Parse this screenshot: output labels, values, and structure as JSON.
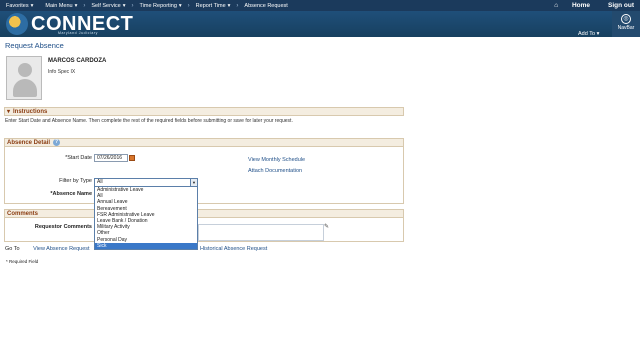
{
  "topnav": {
    "items": [
      {
        "label": "Favorites"
      },
      {
        "label": "Main Menu"
      },
      {
        "label": "Self Service"
      },
      {
        "label": "Time Reporting"
      },
      {
        "label": "Report Time"
      },
      {
        "label": "Absence Request"
      }
    ],
    "home_label": "Home",
    "signout_label": "Sign out"
  },
  "banner": {
    "logo_text": "CONNECT",
    "logo_subtext": "Maryland Judiciary",
    "add_to_label": "Add To",
    "navbar_label": "NavBar"
  },
  "page": {
    "title": "Request Absence"
  },
  "employee": {
    "name": "MARCOS CARDOZA",
    "job_title": "Info Spec IX"
  },
  "instructions": {
    "header": "Instructions",
    "text": "Enter Start Date and Absence Name. Then complete the rest of the required fields before submitting or save for later your request."
  },
  "absence_detail": {
    "header": "Absence Detail",
    "start_date_label": "*Start Date",
    "start_date_value": "07/26/2016",
    "view_monthly_schedule": "View Monthly Schedule",
    "attach_documentation": "Attach Documentation",
    "filter_by_type_label": "Filter by Type",
    "filter_by_type_value": "All",
    "absence_name_label": "*Absence Name",
    "filter_options": [
      "Administrative Leave",
      "All",
      "Annual Leave",
      "Bereavement",
      "FSR Administrative Leave",
      "Leave Bank / Donation",
      "Military Activity",
      "Other",
      "Personal Day",
      "Sick"
    ],
    "highlighted_option": "Sick"
  },
  "comments": {
    "header": "Comments",
    "requestor_label": "Requestor Comments"
  },
  "goto": {
    "label": "Go To",
    "view_absence_request": "View Absence Request",
    "historical": "Historical Absence Request"
  },
  "footer": {
    "required_note": "* Required Field"
  },
  "colors": {
    "nav_bg": "#1b3a5c",
    "banner_bg": "#1f4f7a",
    "link": "#1f4f88",
    "section_header": "#8b3d12",
    "dropdown_highlight": "#3a78c8"
  }
}
